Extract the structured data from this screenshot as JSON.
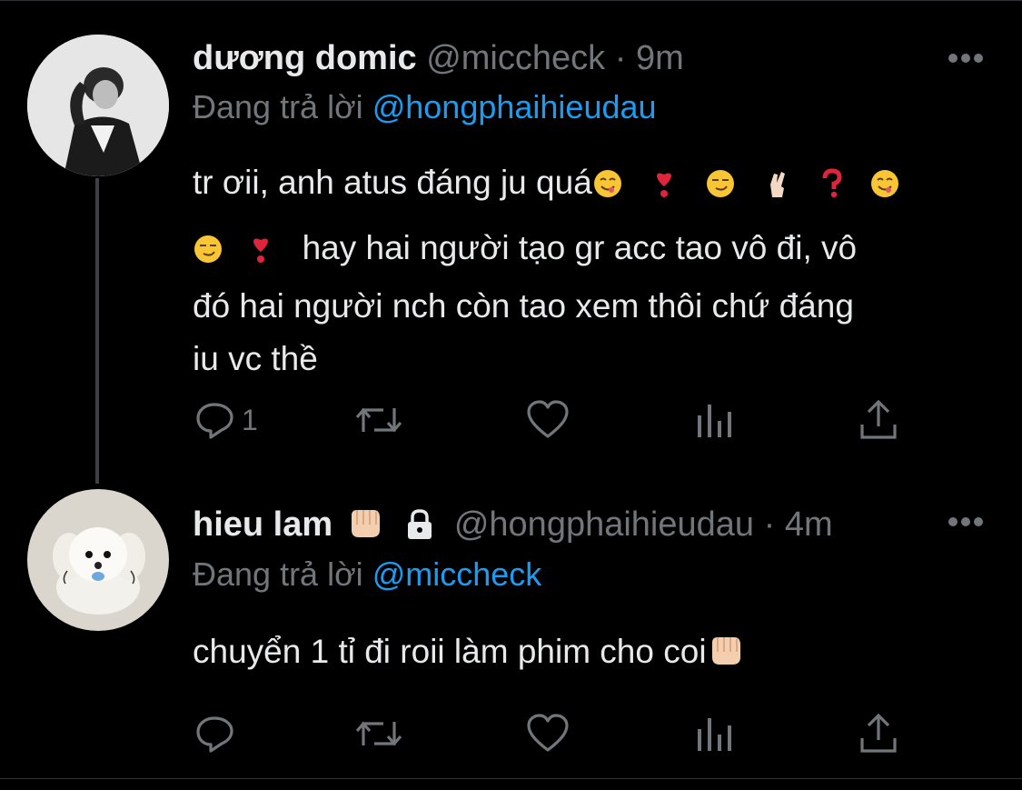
{
  "tweets": [
    {
      "name": "dương domic",
      "handle": "@miccheck",
      "separator": "·",
      "time": "9m",
      "reply_prefix": "Đang trả lời",
      "reply_to": "@hongphaihieudau",
      "text_line1": "tr ơii, anh atus đáng ju quá",
      "text_line2": "hay hai người tạo gr acc tao vô đi, vô",
      "text_line3": "đó hai người nch còn tao xem thôi chứ đáng",
      "text_line4": "iu vc thề",
      "reply_count": "1",
      "icons": [
        "reply-icon",
        "retweet-icon",
        "like-icon",
        "analytics-icon",
        "share-icon"
      ]
    },
    {
      "name": "hieu lam",
      "handle": "@hongphaihieudau",
      "separator": "·",
      "time": "4m",
      "reply_prefix": "Đang trả lời",
      "reply_to": "@miccheck",
      "text_line1": "chuyển 1 tỉ đi roii làm phim cho coi",
      "reply_count": "",
      "icons": [
        "reply-icon",
        "retweet-icon",
        "like-icon",
        "analytics-icon",
        "share-icon"
      ]
    }
  ],
  "colors": {
    "background": "#000000",
    "text": "#e7e9ea",
    "secondary": "#71767b",
    "mention": "#1d9bf0",
    "thread_line": "#3e4144"
  }
}
